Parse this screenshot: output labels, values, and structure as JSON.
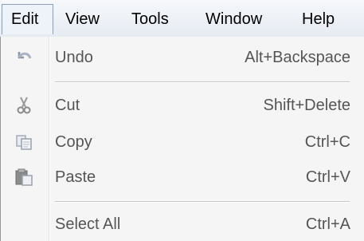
{
  "menubar": {
    "items": [
      {
        "label": "Edit",
        "active": true
      },
      {
        "label": "View"
      },
      {
        "label": "Tools"
      },
      {
        "label": "Window"
      },
      {
        "label": "Help"
      }
    ]
  },
  "edit_menu": {
    "items": [
      {
        "label": "Undo",
        "shortcut": "Alt+Backspace",
        "icon": "undo-icon"
      },
      {
        "label": "Cut",
        "shortcut": "Shift+Delete",
        "icon": "scissors-icon"
      },
      {
        "label": "Copy",
        "shortcut": "Ctrl+C",
        "icon": "copy-icon"
      },
      {
        "label": "Paste",
        "shortcut": "Ctrl+V",
        "icon": "paste-icon"
      },
      {
        "label": "Select All",
        "shortcut": "Ctrl+A",
        "icon": ""
      }
    ]
  },
  "colors": {
    "menu_background": "#f5f5f5",
    "active_tab_background": "#eef3fa",
    "disabled_text": "#555555"
  }
}
